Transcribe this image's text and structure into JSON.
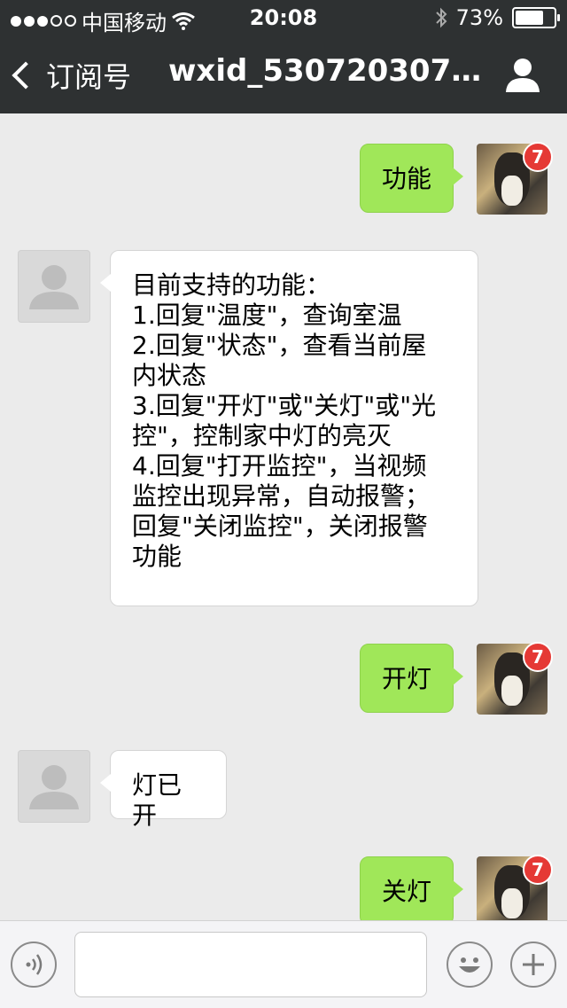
{
  "status": {
    "carrier": "中国移动",
    "time": "20:08",
    "battery": "73%",
    "battery_level": 0.73
  },
  "nav": {
    "back_label": "订阅号",
    "title": "wxid_5307203072…"
  },
  "messages": [
    {
      "side": "me",
      "text": "功能",
      "badge": "7"
    },
    {
      "side": "other",
      "lines": [
        "目前支持的功能：",
        "1.回复\"温度\"，查询室温",
        "2.回复\"状态\"，查看当前屋",
        "内状态",
        "3.回复\"开灯\"或\"关灯\"或\"光",
        "控\"，控制家中灯的亮灭",
        "4.回复\"打开监控\"，当视频",
        "监控出现异常，自动报警；",
        "回复\"关闭监控\"，关闭报警",
        "功能"
      ]
    },
    {
      "side": "me",
      "text": "开灯",
      "badge": "7"
    },
    {
      "side": "other",
      "text": "灯已开"
    },
    {
      "side": "me",
      "text": "关灯",
      "badge": "7"
    }
  ],
  "icons": {
    "signal": "signal-dots-icon",
    "wifi": "wifi-icon",
    "bluetooth": "bluetooth-icon",
    "battery": "battery-icon",
    "back": "chevron-left-icon",
    "profile": "person-icon",
    "voice": "voice-icon",
    "emoji": "emoji-icon",
    "plus": "plus-icon"
  }
}
